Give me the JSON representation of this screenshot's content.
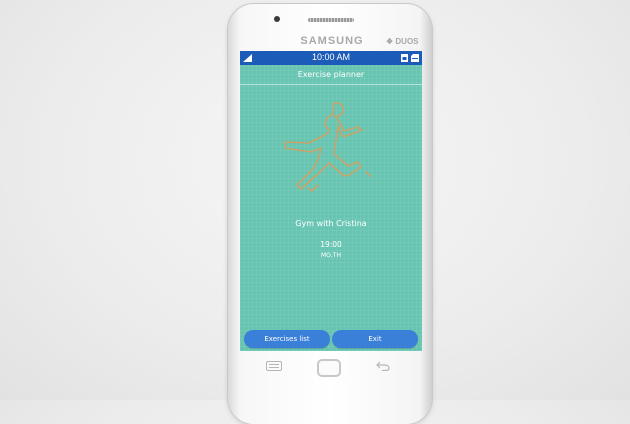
{
  "device": {
    "brand": "SAMSUNG",
    "badge": "DUOS"
  },
  "status_bar": {
    "time": "10:00 AM"
  },
  "app": {
    "title": "Exercise planner",
    "event": {
      "name": "Gym with Cristina",
      "time": "19:00",
      "days": "MO,TH"
    },
    "buttons": {
      "list": "Exercises list",
      "exit": "Exit"
    }
  },
  "icons": [
    "signal-icon",
    "sim-icon",
    "sd-card-icon",
    "runner-illustration",
    "menu-key-icon",
    "home-key-icon",
    "back-key-icon"
  ],
  "colors": {
    "screen_bg": "#67c4b1",
    "status_bar": "#1d5bb8",
    "button": "#3a7fd8",
    "runner": "#c9a36a"
  }
}
